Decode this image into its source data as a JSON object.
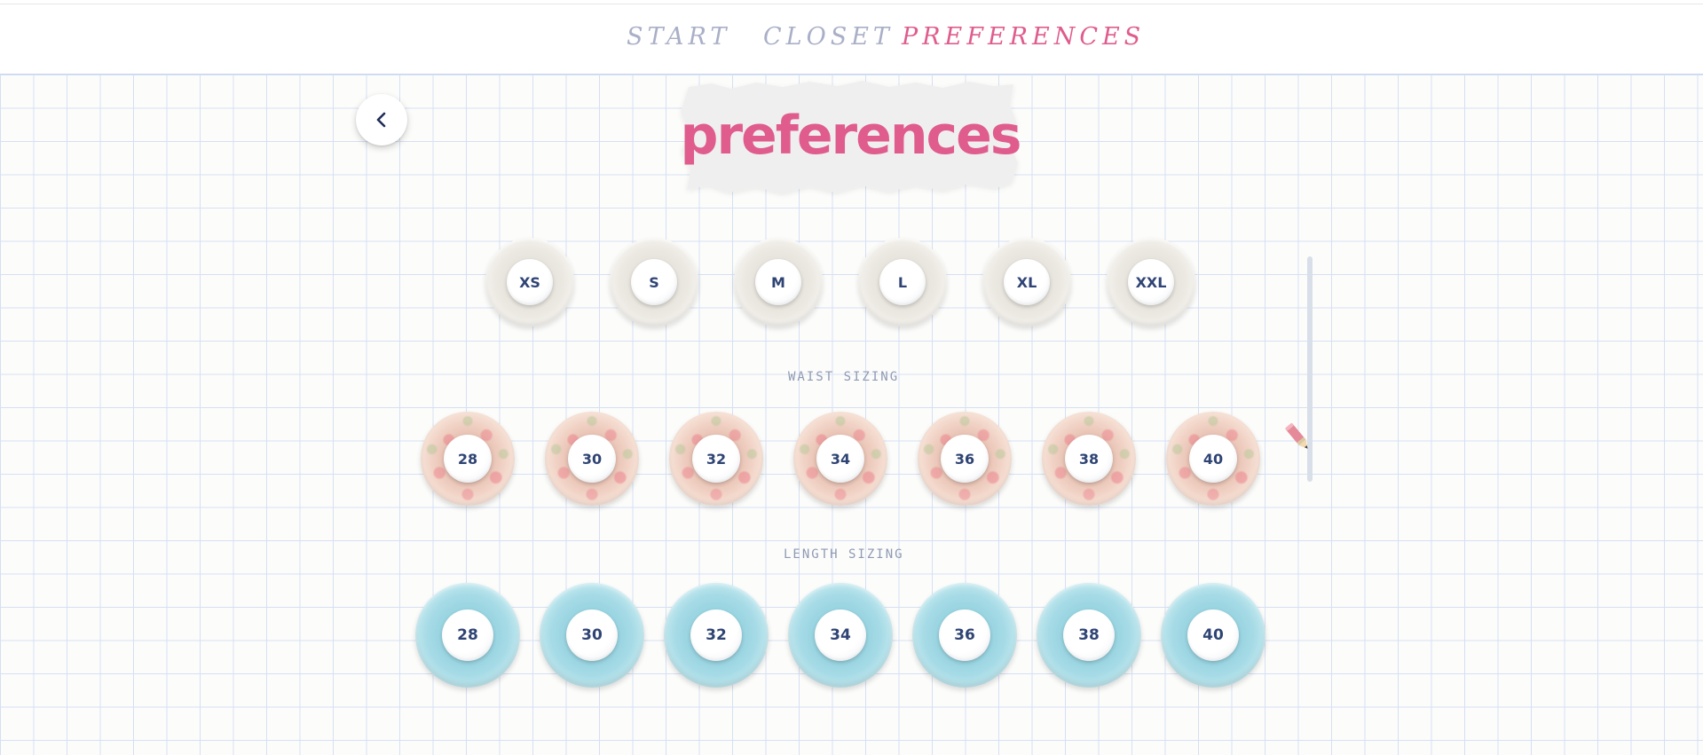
{
  "nav": {
    "items": [
      {
        "label": "START",
        "active": false
      },
      {
        "label": "CLOSET",
        "active": false
      },
      {
        "label": "PREFERENCES",
        "active": true
      }
    ]
  },
  "header": {
    "title": "preferences",
    "back_icon": "chevron-left-icon"
  },
  "sections": {
    "shirt": {
      "options": [
        "XS",
        "S",
        "M",
        "L",
        "XL",
        "XXL"
      ]
    },
    "waist": {
      "label": "WAIST SIZING",
      "options": [
        "28",
        "30",
        "32",
        "34",
        "36",
        "38",
        "40"
      ]
    },
    "length": {
      "label": "LENGTH SIZING",
      "options": [
        "28",
        "30",
        "32",
        "34",
        "36",
        "38",
        "40"
      ]
    }
  },
  "decor": {
    "pencil_icon": "pencil-icon"
  },
  "colors": {
    "accent_pink": "#df5c8d",
    "nav_inactive": "#a9afc7",
    "text_navy": "#2f4474",
    "ring_blue": "#a6dbe6",
    "ring_cream": "#ece9e3"
  }
}
